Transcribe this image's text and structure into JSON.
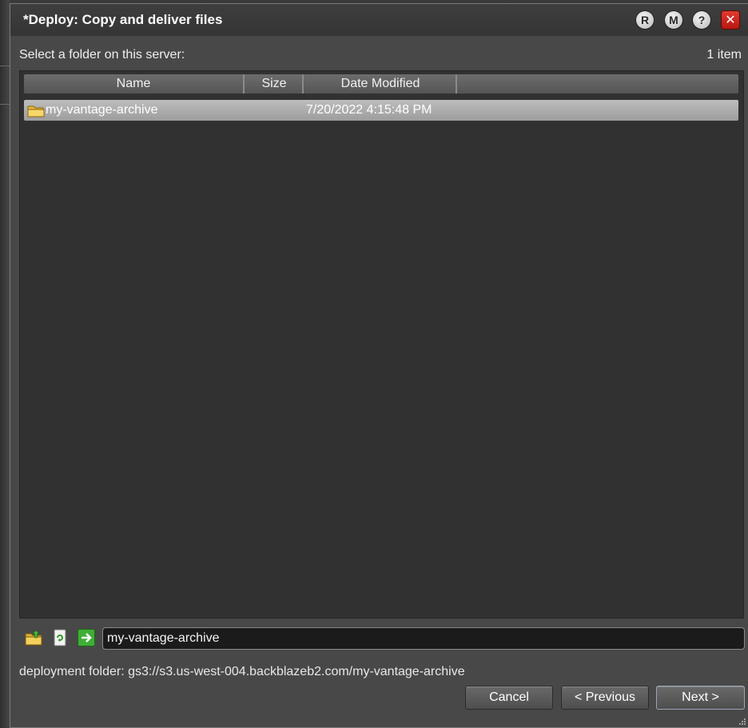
{
  "dialog": {
    "title": "*Deploy: Copy and deliver files",
    "title_buttons": {
      "r": "R",
      "m": "M",
      "help": "?",
      "close": "✕"
    }
  },
  "browser": {
    "prompt": "Select a folder on this server:",
    "item_count": "1 item",
    "columns": {
      "name": "Name",
      "size": "Size",
      "date": "Date Modified"
    },
    "rows": [
      {
        "name": "my-vantage-archive",
        "size": "",
        "date": "7/20/2022 4:15:48 PM",
        "icon": "folder-icon"
      }
    ]
  },
  "path": {
    "value": "my-vantage-archive",
    "icons": [
      "folder-up-icon",
      "refresh-icon",
      "go-arrow-icon"
    ]
  },
  "deployment_folder": "deployment folder: gs3://s3.us-west-004.backblazeb2.com/my-vantage-archive",
  "buttons": {
    "cancel": "Cancel",
    "previous": "< Previous",
    "next": "Next >"
  },
  "colors": {
    "accent_close": "#d1281e",
    "selected_row": "#aeaeae",
    "dialog_bg": "#484848",
    "list_bg": "#313131"
  }
}
